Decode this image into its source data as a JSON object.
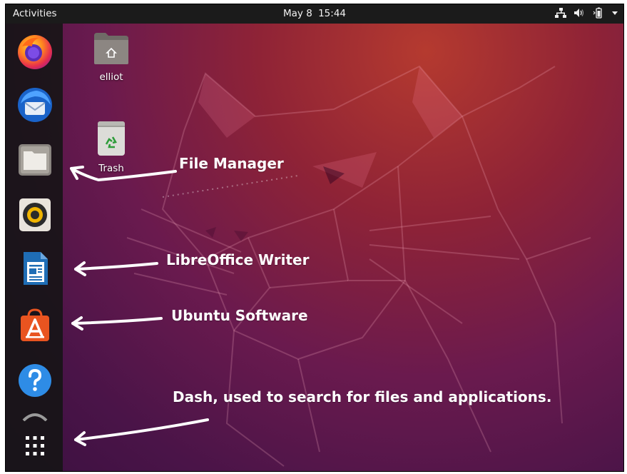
{
  "topbar": {
    "activities_label": "Activities",
    "date": "May 8",
    "time": "15:44",
    "tray_icons": [
      "network-icon",
      "volume-icon",
      "battery-icon",
      "system-menu-chevron-icon"
    ]
  },
  "dock": {
    "items": [
      {
        "name": "firefox",
        "icon": "firefox-icon"
      },
      {
        "name": "thunderbird",
        "icon": "thunderbird-icon"
      },
      {
        "name": "files",
        "icon": "file-manager-icon"
      },
      {
        "name": "rhythmbox",
        "icon": "rhythmbox-icon"
      },
      {
        "name": "libreoffice-writer",
        "icon": "libreoffice-writer-icon"
      },
      {
        "name": "ubuntu-software",
        "icon": "ubuntu-software-icon"
      },
      {
        "name": "help",
        "icon": "help-icon"
      },
      {
        "name": "show-applications",
        "icon": "app-grid-icon"
      }
    ]
  },
  "desktop": {
    "home_label": "elliot",
    "trash_label": "Trash"
  },
  "annotations": {
    "file_manager": "File Manager",
    "writer": "LibreOffice Writer",
    "software": "Ubuntu Software",
    "dash": "Dash, used to search for files and applications."
  },
  "colors": {
    "topbar": "#1b1b1b",
    "dock": "#141414",
    "wallpaper_top": "#b53a2f",
    "wallpaper_bottom": "#3b1040",
    "annotation_text": "#ffffff"
  }
}
